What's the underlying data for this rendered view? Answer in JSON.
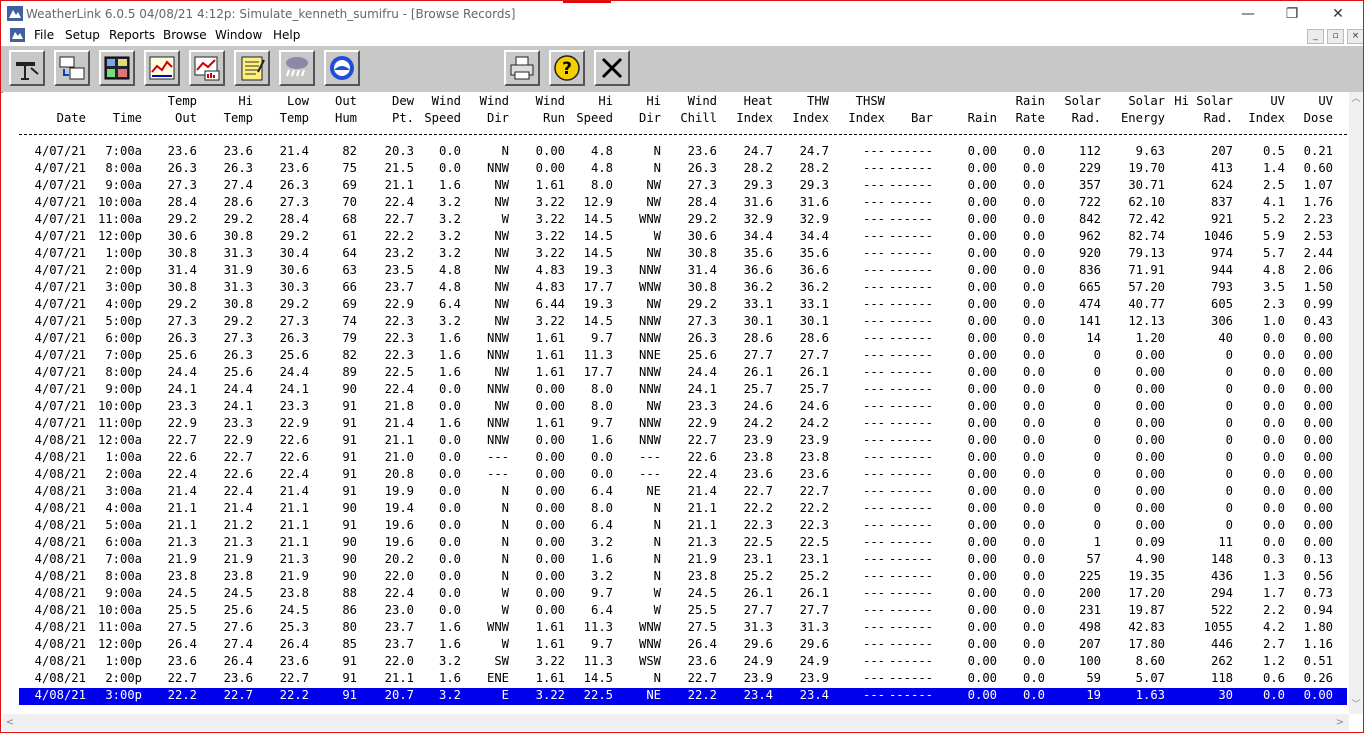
{
  "window": {
    "title": "WeatherLink 6.0.5  04/08/21  4:12p: Simulate_kenneth_sumifru - [Browse Records]",
    "minimize": "—",
    "restore": "❐",
    "close": "✕"
  },
  "menu": {
    "items": [
      "File",
      "Setup",
      "Reports",
      "Browse",
      "Window",
      "Help"
    ],
    "mdi": [
      "_",
      "▫",
      "×"
    ]
  },
  "toolbar": {
    "buttons": [
      "station-setup-icon",
      "download-icon",
      "bulletin-icon",
      "strip-chart-icon",
      "plot-icon",
      "noaa-report-icon",
      "weather-icon",
      "noaa-logo-icon",
      "print-icon",
      "help-icon",
      "close-icon"
    ]
  },
  "table": {
    "header_top": [
      "",
      "",
      "Temp",
      "Hi",
      "Low",
      "Out",
      "Dew",
      "Wind",
      "Wind",
      "Wind",
      "Hi",
      "Hi",
      "Wind",
      "Heat",
      "THW",
      "THSW",
      "",
      "",
      "Rain",
      "Solar",
      "Solar",
      "Hi Solar",
      "UV",
      "UV"
    ],
    "header_bottom": [
      "Date",
      "Time",
      "Out",
      "Temp",
      "Temp",
      "Hum",
      "Pt.",
      "Speed",
      "Dir",
      "Run",
      "Speed",
      "Dir",
      "Chill",
      "Index",
      "Index",
      "Index",
      "Bar",
      "Rain",
      "Rate",
      "Rad.",
      "Energy",
      "Rad.",
      "Index",
      "Dose"
    ],
    "rows": [
      [
        "4/07/21",
        "7:00a",
        "23.6",
        "23.6",
        "21.4",
        "82",
        "20.3",
        "0.0",
        "N",
        "0.00",
        "4.8",
        "N",
        "23.6",
        "24.7",
        "24.7",
        "---",
        "------",
        "0.00",
        "0.0",
        "112",
        "9.63",
        "207",
        "0.5",
        "0.21"
      ],
      [
        "4/07/21",
        "8:00a",
        "26.3",
        "26.3",
        "23.6",
        "75",
        "21.5",
        "0.0",
        "NNW",
        "0.00",
        "4.8",
        "N",
        "26.3",
        "28.2",
        "28.2",
        "---",
        "------",
        "0.00",
        "0.0",
        "229",
        "19.70",
        "413",
        "1.4",
        "0.60"
      ],
      [
        "4/07/21",
        "9:00a",
        "27.3",
        "27.4",
        "26.3",
        "69",
        "21.1",
        "1.6",
        "NW",
        "1.61",
        "8.0",
        "NW",
        "27.3",
        "29.3",
        "29.3",
        "---",
        "------",
        "0.00",
        "0.0",
        "357",
        "30.71",
        "624",
        "2.5",
        "1.07"
      ],
      [
        "4/07/21",
        "10:00a",
        "28.4",
        "28.6",
        "27.3",
        "70",
        "22.4",
        "3.2",
        "NW",
        "3.22",
        "12.9",
        "NW",
        "28.4",
        "31.6",
        "31.6",
        "---",
        "------",
        "0.00",
        "0.0",
        "722",
        "62.10",
        "837",
        "4.1",
        "1.76"
      ],
      [
        "4/07/21",
        "11:00a",
        "29.2",
        "29.2",
        "28.4",
        "68",
        "22.7",
        "3.2",
        "W",
        "3.22",
        "14.5",
        "WNW",
        "29.2",
        "32.9",
        "32.9",
        "---",
        "------",
        "0.00",
        "0.0",
        "842",
        "72.42",
        "921",
        "5.2",
        "2.23"
      ],
      [
        "4/07/21",
        "12:00p",
        "30.6",
        "30.8",
        "29.2",
        "61",
        "22.2",
        "3.2",
        "NW",
        "3.22",
        "14.5",
        "W",
        "30.6",
        "34.4",
        "34.4",
        "---",
        "------",
        "0.00",
        "0.0",
        "962",
        "82.74",
        "1046",
        "5.9",
        "2.53"
      ],
      [
        "4/07/21",
        "1:00p",
        "30.8",
        "31.3",
        "30.4",
        "64",
        "23.2",
        "3.2",
        "NW",
        "3.22",
        "14.5",
        "NW",
        "30.8",
        "35.6",
        "35.6",
        "---",
        "------",
        "0.00",
        "0.0",
        "920",
        "79.13",
        "974",
        "5.7",
        "2.44"
      ],
      [
        "4/07/21",
        "2:00p",
        "31.4",
        "31.9",
        "30.6",
        "63",
        "23.5",
        "4.8",
        "NW",
        "4.83",
        "19.3",
        "NNW",
        "31.4",
        "36.6",
        "36.6",
        "---",
        "------",
        "0.00",
        "0.0",
        "836",
        "71.91",
        "944",
        "4.8",
        "2.06"
      ],
      [
        "4/07/21",
        "3:00p",
        "30.8",
        "31.3",
        "30.3",
        "66",
        "23.7",
        "4.8",
        "NW",
        "4.83",
        "17.7",
        "WNW",
        "30.8",
        "36.2",
        "36.2",
        "---",
        "------",
        "0.00",
        "0.0",
        "665",
        "57.20",
        "793",
        "3.5",
        "1.50"
      ],
      [
        "4/07/21",
        "4:00p",
        "29.2",
        "30.8",
        "29.2",
        "69",
        "22.9",
        "6.4",
        "NW",
        "6.44",
        "19.3",
        "NW",
        "29.2",
        "33.1",
        "33.1",
        "---",
        "------",
        "0.00",
        "0.0",
        "474",
        "40.77",
        "605",
        "2.3",
        "0.99"
      ],
      [
        "4/07/21",
        "5:00p",
        "27.3",
        "29.2",
        "27.3",
        "74",
        "22.3",
        "3.2",
        "NW",
        "3.22",
        "14.5",
        "NNW",
        "27.3",
        "30.1",
        "30.1",
        "---",
        "------",
        "0.00",
        "0.0",
        "141",
        "12.13",
        "306",
        "1.0",
        "0.43"
      ],
      [
        "4/07/21",
        "6:00p",
        "26.3",
        "27.3",
        "26.3",
        "79",
        "22.3",
        "1.6",
        "NNW",
        "1.61",
        "9.7",
        "NNW",
        "26.3",
        "28.6",
        "28.6",
        "---",
        "------",
        "0.00",
        "0.0",
        "14",
        "1.20",
        "40",
        "0.0",
        "0.00"
      ],
      [
        "4/07/21",
        "7:00p",
        "25.6",
        "26.3",
        "25.6",
        "82",
        "22.3",
        "1.6",
        "NNW",
        "1.61",
        "11.3",
        "NNE",
        "25.6",
        "27.7",
        "27.7",
        "---",
        "------",
        "0.00",
        "0.0",
        "0",
        "0.00",
        "0",
        "0.0",
        "0.00"
      ],
      [
        "4/07/21",
        "8:00p",
        "24.4",
        "25.6",
        "24.4",
        "89",
        "22.5",
        "1.6",
        "NW",
        "1.61",
        "17.7",
        "NNW",
        "24.4",
        "26.1",
        "26.1",
        "---",
        "------",
        "0.00",
        "0.0",
        "0",
        "0.00",
        "0",
        "0.0",
        "0.00"
      ],
      [
        "4/07/21",
        "9:00p",
        "24.1",
        "24.4",
        "24.1",
        "90",
        "22.4",
        "0.0",
        "NNW",
        "0.00",
        "8.0",
        "NNW",
        "24.1",
        "25.7",
        "25.7",
        "---",
        "------",
        "0.00",
        "0.0",
        "0",
        "0.00",
        "0",
        "0.0",
        "0.00"
      ],
      [
        "4/07/21",
        "10:00p",
        "23.3",
        "24.1",
        "23.3",
        "91",
        "21.8",
        "0.0",
        "NW",
        "0.00",
        "8.0",
        "NW",
        "23.3",
        "24.6",
        "24.6",
        "---",
        "------",
        "0.00",
        "0.0",
        "0",
        "0.00",
        "0",
        "0.0",
        "0.00"
      ],
      [
        "4/07/21",
        "11:00p",
        "22.9",
        "23.3",
        "22.9",
        "91",
        "21.4",
        "1.6",
        "NNW",
        "1.61",
        "9.7",
        "NNW",
        "22.9",
        "24.2",
        "24.2",
        "---",
        "------",
        "0.00",
        "0.0",
        "0",
        "0.00",
        "0",
        "0.0",
        "0.00"
      ],
      [
        "4/08/21",
        "12:00a",
        "22.7",
        "22.9",
        "22.6",
        "91",
        "21.1",
        "0.0",
        "NNW",
        "0.00",
        "1.6",
        "NNW",
        "22.7",
        "23.9",
        "23.9",
        "---",
        "------",
        "0.00",
        "0.0",
        "0",
        "0.00",
        "0",
        "0.0",
        "0.00"
      ],
      [
        "4/08/21",
        "1:00a",
        "22.6",
        "22.7",
        "22.6",
        "91",
        "21.0",
        "0.0",
        "---",
        "0.00",
        "0.0",
        "---",
        "22.6",
        "23.8",
        "23.8",
        "---",
        "------",
        "0.00",
        "0.0",
        "0",
        "0.00",
        "0",
        "0.0",
        "0.00"
      ],
      [
        "4/08/21",
        "2:00a",
        "22.4",
        "22.6",
        "22.4",
        "91",
        "20.8",
        "0.0",
        "---",
        "0.00",
        "0.0",
        "---",
        "22.4",
        "23.6",
        "23.6",
        "---",
        "------",
        "0.00",
        "0.0",
        "0",
        "0.00",
        "0",
        "0.0",
        "0.00"
      ],
      [
        "4/08/21",
        "3:00a",
        "21.4",
        "22.4",
        "21.4",
        "91",
        "19.9",
        "0.0",
        "N",
        "0.00",
        "6.4",
        "NE",
        "21.4",
        "22.7",
        "22.7",
        "---",
        "------",
        "0.00",
        "0.0",
        "0",
        "0.00",
        "0",
        "0.0",
        "0.00"
      ],
      [
        "4/08/21",
        "4:00a",
        "21.1",
        "21.4",
        "21.1",
        "90",
        "19.4",
        "0.0",
        "N",
        "0.00",
        "8.0",
        "N",
        "21.1",
        "22.2",
        "22.2",
        "---",
        "------",
        "0.00",
        "0.0",
        "0",
        "0.00",
        "0",
        "0.0",
        "0.00"
      ],
      [
        "4/08/21",
        "5:00a",
        "21.1",
        "21.2",
        "21.1",
        "91",
        "19.6",
        "0.0",
        "N",
        "0.00",
        "6.4",
        "N",
        "21.1",
        "22.3",
        "22.3",
        "---",
        "------",
        "0.00",
        "0.0",
        "0",
        "0.00",
        "0",
        "0.0",
        "0.00"
      ],
      [
        "4/08/21",
        "6:00a",
        "21.3",
        "21.3",
        "21.1",
        "90",
        "19.6",
        "0.0",
        "N",
        "0.00",
        "3.2",
        "N",
        "21.3",
        "22.5",
        "22.5",
        "---",
        "------",
        "0.00",
        "0.0",
        "1",
        "0.09",
        "11",
        "0.0",
        "0.00"
      ],
      [
        "4/08/21",
        "7:00a",
        "21.9",
        "21.9",
        "21.3",
        "90",
        "20.2",
        "0.0",
        "N",
        "0.00",
        "1.6",
        "N",
        "21.9",
        "23.1",
        "23.1",
        "---",
        "------",
        "0.00",
        "0.0",
        "57",
        "4.90",
        "148",
        "0.3",
        "0.13"
      ],
      [
        "4/08/21",
        "8:00a",
        "23.8",
        "23.8",
        "21.9",
        "90",
        "22.0",
        "0.0",
        "N",
        "0.00",
        "3.2",
        "N",
        "23.8",
        "25.2",
        "25.2",
        "---",
        "------",
        "0.00",
        "0.0",
        "225",
        "19.35",
        "436",
        "1.3",
        "0.56"
      ],
      [
        "4/08/21",
        "9:00a",
        "24.5",
        "24.5",
        "23.8",
        "88",
        "22.4",
        "0.0",
        "W",
        "0.00",
        "9.7",
        "W",
        "24.5",
        "26.1",
        "26.1",
        "---",
        "------",
        "0.00",
        "0.0",
        "200",
        "17.20",
        "294",
        "1.7",
        "0.73"
      ],
      [
        "4/08/21",
        "10:00a",
        "25.5",
        "25.6",
        "24.5",
        "86",
        "23.0",
        "0.0",
        "W",
        "0.00",
        "6.4",
        "W",
        "25.5",
        "27.7",
        "27.7",
        "---",
        "------",
        "0.00",
        "0.0",
        "231",
        "19.87",
        "522",
        "2.2",
        "0.94"
      ],
      [
        "4/08/21",
        "11:00a",
        "27.5",
        "27.6",
        "25.3",
        "80",
        "23.7",
        "1.6",
        "WNW",
        "1.61",
        "11.3",
        "WNW",
        "27.5",
        "31.3",
        "31.3",
        "---",
        "------",
        "0.00",
        "0.0",
        "498",
        "42.83",
        "1055",
        "4.2",
        "1.80"
      ],
      [
        "4/08/21",
        "12:00p",
        "26.4",
        "27.4",
        "26.4",
        "85",
        "23.7",
        "1.6",
        "W",
        "1.61",
        "9.7",
        "WNW",
        "26.4",
        "29.6",
        "29.6",
        "---",
        "------",
        "0.00",
        "0.0",
        "207",
        "17.80",
        "446",
        "2.7",
        "1.16"
      ],
      [
        "4/08/21",
        "1:00p",
        "23.6",
        "26.4",
        "23.6",
        "91",
        "22.0",
        "3.2",
        "SW",
        "3.22",
        "11.3",
        "WSW",
        "23.6",
        "24.9",
        "24.9",
        "---",
        "------",
        "0.00",
        "0.0",
        "100",
        "8.60",
        "262",
        "1.2",
        "0.51"
      ],
      [
        "4/08/21",
        "2:00p",
        "22.7",
        "23.6",
        "22.7",
        "91",
        "21.1",
        "1.6",
        "ENE",
        "1.61",
        "14.5",
        "N",
        "22.7",
        "23.9",
        "23.9",
        "---",
        "------",
        "0.00",
        "0.0",
        "59",
        "5.07",
        "118",
        "0.6",
        "0.26"
      ],
      [
        "4/08/21",
        "3:00p",
        "22.2",
        "22.7",
        "22.2",
        "91",
        "20.7",
        "3.2",
        "E",
        "3.22",
        "22.5",
        "NE",
        "22.2",
        "23.4",
        "23.4",
        "---",
        "------",
        "0.00",
        "0.0",
        "19",
        "1.63",
        "30",
        "0.0",
        "0.00"
      ]
    ],
    "selected_index": 32
  },
  "scroll": {
    "up": "︿",
    "down": "﹀",
    "left": "<",
    "right": ">"
  },
  "colors": {
    "selection": "#0000ee",
    "toolbar": "#c8c8c8",
    "border": "#dd1111"
  }
}
